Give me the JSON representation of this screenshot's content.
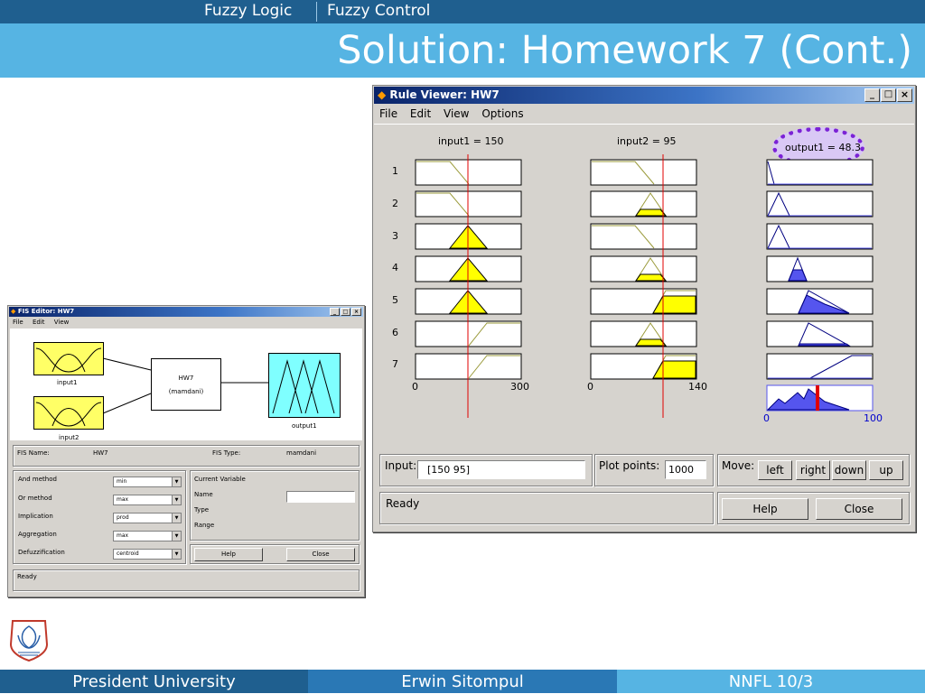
{
  "header": {
    "tab_left": "Fuzzy Logic",
    "tab_right": "Fuzzy Control",
    "title": "Solution: Homework 7 (Cont.)"
  },
  "footer": {
    "left": "President University",
    "center": "Erwin Sitompul",
    "right": "NNFL 10/3"
  },
  "fis_editor": {
    "title": "FIS Editor: HW7",
    "menu": [
      "File",
      "Edit",
      "View"
    ],
    "input1_label": "input1",
    "input2_label": "input2",
    "system_name": "HW7",
    "system_type_paren": "(mamdani)",
    "output_label": "output1",
    "fis_name_label": "FIS Name:",
    "fis_name_value": "HW7",
    "fis_type_label": "FIS Type:",
    "fis_type_value": "mamdani",
    "methods": [
      {
        "label": "And method",
        "value": "min"
      },
      {
        "label": "Or method",
        "value": "max"
      },
      {
        "label": "Implication",
        "value": "prod"
      },
      {
        "label": "Aggregation",
        "value": "max"
      },
      {
        "label": "Defuzzification",
        "value": "centroid"
      }
    ],
    "current_variable_label": "Current Variable",
    "name_label": "Name",
    "type_label": "Type",
    "range_label": "Range",
    "help_label": "Help",
    "close_label": "Close",
    "status": "Ready"
  },
  "rule_viewer": {
    "title": "Rule Viewer: HW7",
    "menu": [
      "File",
      "Edit",
      "View",
      "Options"
    ],
    "input1_header": "input1 = 150",
    "input2_header": "input2 = 95",
    "output_header": "output1 = 48.3",
    "rule_numbers": [
      "1",
      "2",
      "3",
      "4",
      "5",
      "6",
      "7"
    ],
    "input1_axis": [
      "0",
      "300"
    ],
    "input2_axis": [
      "0",
      "140"
    ],
    "output_axis": [
      "0",
      "100"
    ],
    "input_label": "Input:",
    "input_value": "[150 95]",
    "plot_points_label": "Plot points:",
    "plot_points_value": "1000",
    "move_label": "Move:",
    "move_buttons": [
      "left",
      "right",
      "down",
      "up"
    ],
    "status": "Ready",
    "help_label": "Help",
    "close_label": "Close",
    "colors": {
      "mf_fill": "#ffff00",
      "output_fill": "#5555ee",
      "output_line": "#000080",
      "indicator": "#e00000",
      "highlight_dots": "#7b22d6",
      "highlight_fill": "#d9c8f5"
    }
  }
}
